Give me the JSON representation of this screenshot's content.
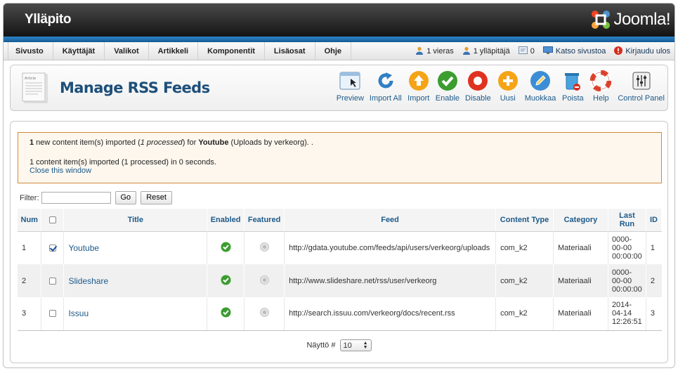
{
  "header": {
    "title": "Ylläpito",
    "logo_text": "Joomla!"
  },
  "menu": [
    "Sivusto",
    "Käyttäjät",
    "Valikot",
    "Artikkeli",
    "Komponentit",
    "Lisäosat",
    "Ohje"
  ],
  "status": {
    "visitors": "1 vieras",
    "admins": "1 ylläpitäjä",
    "messages": "0",
    "view_site": "Katso sivustoa",
    "logout": "Kirjaudu ulos"
  },
  "toolbar": {
    "page_icon_text": "Article",
    "title": "Manage RSS Feeds",
    "buttons": [
      {
        "label": "Preview",
        "icon": "preview-icon"
      },
      {
        "label": "Import All",
        "icon": "refresh-icon"
      },
      {
        "label": "Import",
        "icon": "up-arrow-icon"
      },
      {
        "label": "Enable",
        "icon": "check-icon"
      },
      {
        "label": "Disable",
        "icon": "disable-icon"
      },
      {
        "label": "Uusi",
        "icon": "plus-icon"
      },
      {
        "label": "Muokkaa",
        "icon": "pencil-icon"
      },
      {
        "label": "Poista",
        "icon": "trash-icon"
      },
      {
        "label": "Help",
        "icon": "lifebuoy-icon"
      },
      {
        "label": "Control Panel",
        "icon": "control-panel-icon"
      }
    ]
  },
  "message": {
    "count": "1",
    "text_a": " new content item(s) imported (",
    "processed": "1 processed",
    "text_b": ") for ",
    "feed": "Youtube",
    "text_c": " (Uploads by verkeorg). .",
    "summary": "1 content item(s) imported (1 processed) in 0 seconds.",
    "close": "Close this window"
  },
  "filter": {
    "label": "Filter:",
    "value": "",
    "go": "Go",
    "reset": "Reset"
  },
  "table": {
    "headers": {
      "num": "Num",
      "title": "Title",
      "enabled": "Enabled",
      "featured": "Featured",
      "feed": "Feed",
      "content_type": "Content Type",
      "category": "Category",
      "last_run": "Last Run",
      "id": "ID"
    },
    "rows": [
      {
        "num": "1",
        "checked": true,
        "title": "Youtube",
        "feed": "http://gdata.youtube.com/feeds/api/users/verkeorg/uploads",
        "content_type": "com_k2",
        "category": "Materiaali",
        "last_run_1": "0000-",
        "last_run_2": "00-00",
        "last_run_3": "00:00:00",
        "id": "1"
      },
      {
        "num": "2",
        "checked": false,
        "title": "Slideshare",
        "feed": "http://www.slideshare.net/rss/user/verkeorg",
        "content_type": "com_k2",
        "category": "Materiaali",
        "last_run_1": "0000-",
        "last_run_2": "00-00",
        "last_run_3": "00:00:00",
        "id": "2"
      },
      {
        "num": "3",
        "checked": false,
        "title": "Issuu",
        "feed": "http://search.issuu.com/verkeorg/docs/recent.rss",
        "content_type": "com_k2",
        "category": "Materiaali",
        "last_run_1": "2014-",
        "last_run_2": "04-14",
        "last_run_3": "12:26:51",
        "id": "3"
      }
    ]
  },
  "pager": {
    "label": "Näyttö #",
    "value": "10"
  }
}
